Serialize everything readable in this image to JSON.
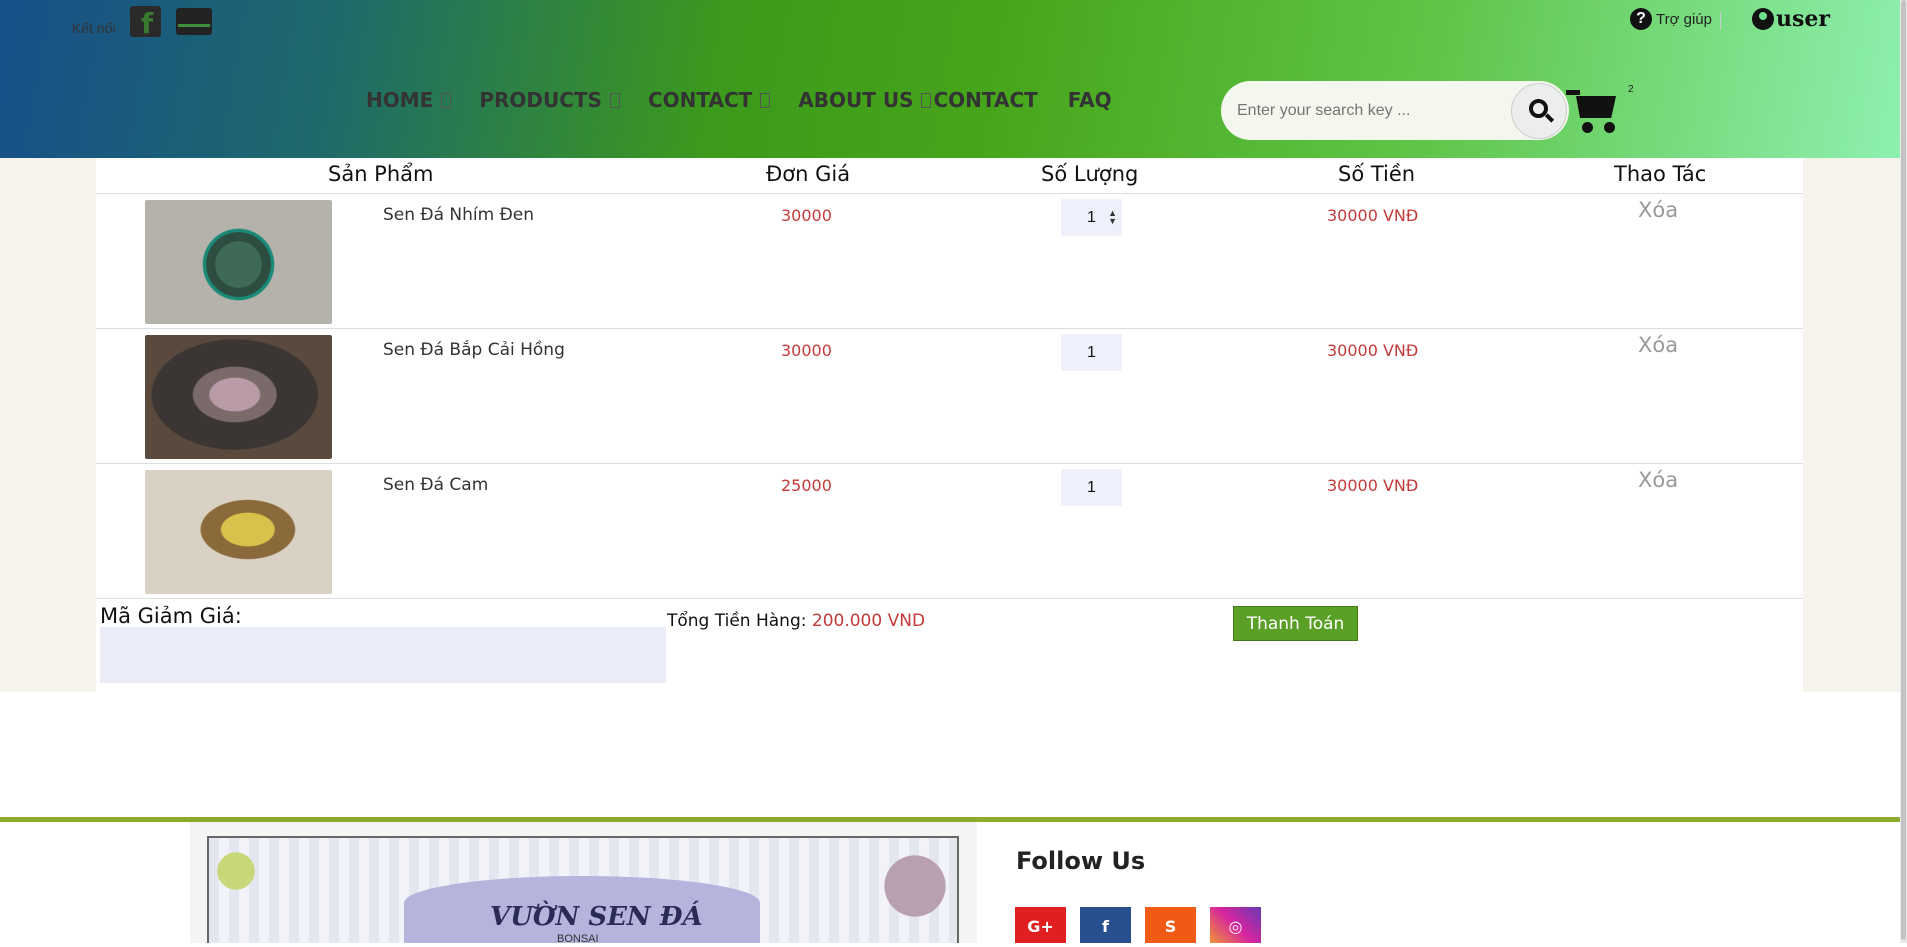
{
  "topbar": {
    "connect_label": "Kết nối",
    "help_label": "Trợ giúp",
    "user_label": "user",
    "cart_count": "2"
  },
  "nav": {
    "items": [
      "HOME",
      "PRODUCTS",
      "CONTACT",
      "ABOUT US",
      "CONTACT",
      "FAQ"
    ]
  },
  "search": {
    "placeholder": "Enter your search key ..."
  },
  "table": {
    "headers": [
      "Sản Phẩm",
      "Đơn Giá",
      "Số Lượng",
      "Số Tiền",
      "Thao Tác"
    ],
    "rows": [
      {
        "name": "Sen Đá Nhím Đen",
        "price": "30000",
        "qty": "1",
        "amount": "30000 VNĐ",
        "action": "Xóa"
      },
      {
        "name": "Sen Đá Bắp Cải Hồng",
        "price": "30000",
        "qty": "1",
        "amount": "30000 VNĐ",
        "action": "Xóa"
      },
      {
        "name": "Sen Đá Cam",
        "price": "25000",
        "qty": "1",
        "amount": "30000 VNĐ",
        "action": "Xóa"
      }
    ]
  },
  "summary": {
    "discount_label": "Mã Giảm Giá:",
    "total_label": "Tổng Tiền Hàng:",
    "total_value": "200.000 VND",
    "pay_button": "Thanh Toán"
  },
  "footer": {
    "banner_title": "VƯỜN SEN ĐÁ",
    "banner_sub": "BONSAI",
    "follow_title": "Follow Us",
    "social": [
      "G+",
      "f",
      "S",
      "◎"
    ]
  },
  "colors": {
    "accent": "#5aa026",
    "price": "#c43a3a",
    "footer_line": "#8cab2e"
  }
}
